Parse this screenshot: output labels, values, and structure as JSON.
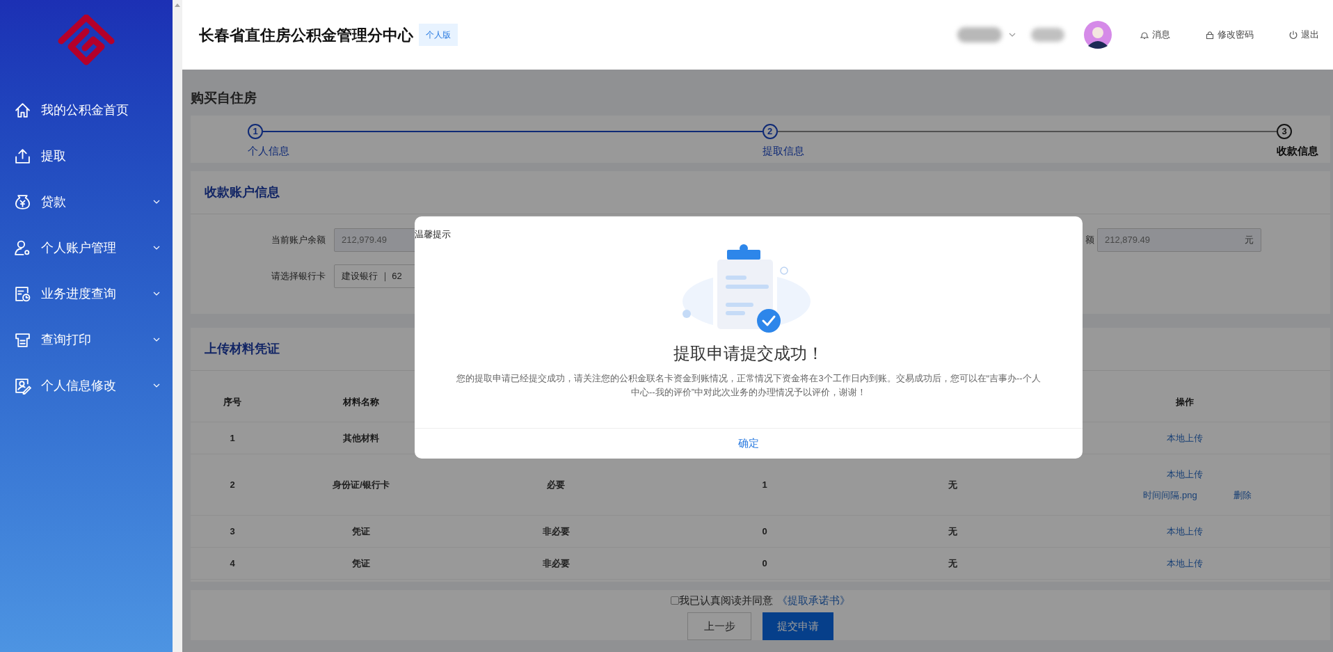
{
  "sidebar": {
    "items": [
      {
        "label": "我的公积金首页",
        "kind": "link"
      },
      {
        "label": "提取",
        "kind": "link"
      },
      {
        "label": "贷款",
        "kind": "submenu"
      },
      {
        "label": "个人账户管理",
        "kind": "submenu"
      },
      {
        "label": "业务进度查询",
        "kind": "submenu"
      },
      {
        "label": "查询打印",
        "kind": "submenu"
      },
      {
        "label": "个人信息修改",
        "kind": "submenu"
      }
    ]
  },
  "header": {
    "title": "长春省直住房公积金管理分中心",
    "badge": "个人版",
    "actions": [
      "消息",
      "修改密码",
      "退出"
    ]
  },
  "page_title": "购买自住房",
  "steps": [
    {
      "number": "1",
      "label": "个人信息",
      "completed": true
    },
    {
      "number": "2",
      "label": "提取信息",
      "completed": true
    },
    {
      "number": "3",
      "label": "收款信息",
      "completed": false
    }
  ],
  "account_section": {
    "title": "收款账户信息",
    "fields": [
      {
        "label": "当前账户余额",
        "value": "212,979.49",
        "disabled": true
      },
      {
        "label": "额",
        "value": "212,879.49",
        "unit": "元",
        "disabled": true
      },
      {
        "label": "请选择银行卡",
        "value": "建设银行 ｜ 62",
        "disabled": false
      }
    ]
  },
  "upload_section": {
    "title": "上传材料凭证",
    "table": {
      "columns": [
        "序号",
        "材料名称",
        null,
        null,
        null,
        "操作"
      ],
      "rows": [
        {
          "cells": [
            "1",
            "其他材料",
            null,
            null,
            null
          ],
          "actions": [
            "本地上传"
          ]
        },
        {
          "cells": [
            "2",
            "身份证/银行卡",
            "必要",
            "1",
            "无"
          ],
          "actions": [
            "本地上传"
          ],
          "file": {
            "name": "时间间隔.png",
            "delete": "删除"
          }
        },
        {
          "cells": [
            "3",
            "凭证",
            "非必要",
            "0",
            "无"
          ],
          "actions": [
            "本地上传"
          ]
        },
        {
          "cells": [
            "4",
            "凭证",
            "非必要",
            "0",
            "无"
          ],
          "actions": [
            "本地上传"
          ]
        }
      ]
    }
  },
  "agreement": {
    "checked": false,
    "text": "我已认真阅读并同意",
    "link": "《提取承诺书》"
  },
  "buttons": {
    "prev": "上一步",
    "submit": "提交申请"
  },
  "modal": {
    "title": "温馨提示",
    "heading": "提取申请提交成功！",
    "message": "您的提取申请已经提交成功，请关注您的公积金联名卡资金到账情况，正常情况下资金将在3个工作日内到账。交易成功后，您可以在“吉事办--个人中心--我的评价”中对此次业务的办理情况予以评价，谢谢！",
    "button": "确定"
  }
}
